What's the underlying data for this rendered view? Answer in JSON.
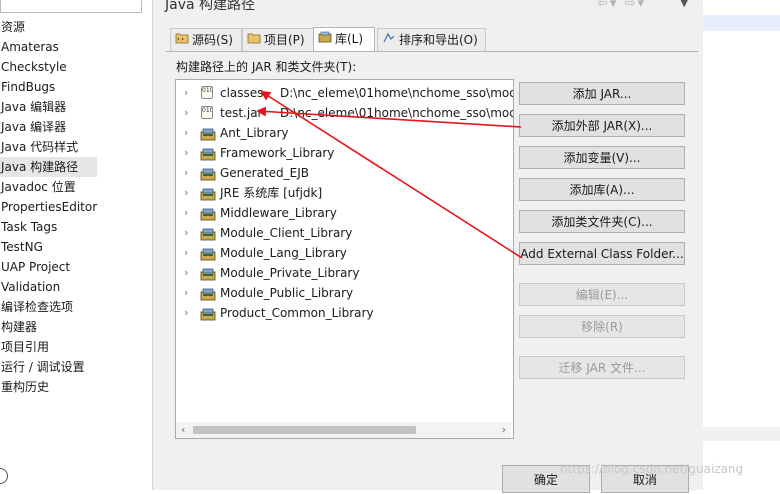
{
  "left_tree": {
    "items": [
      {
        "label": "资源",
        "selected": false
      },
      {
        "label": "Amateras",
        "selected": false
      },
      {
        "label": "Checkstyle",
        "selected": false
      },
      {
        "label": "FindBugs",
        "selected": false
      },
      {
        "label": "Java 编辑器",
        "selected": false
      },
      {
        "label": "Java 编译器",
        "selected": false
      },
      {
        "label": "Java 代码样式",
        "selected": false
      },
      {
        "label": "Java 构建路径",
        "selected": true
      },
      {
        "label": "Javadoc 位置",
        "selected": false
      },
      {
        "label": "PropertiesEditor",
        "selected": false
      },
      {
        "label": "Task Tags",
        "selected": false
      },
      {
        "label": "TestNG",
        "selected": false
      },
      {
        "label": "UAP Project",
        "selected": false
      },
      {
        "label": "Validation",
        "selected": false
      },
      {
        "label": "编译检查选项",
        "selected": false
      },
      {
        "label": "构建器",
        "selected": false
      },
      {
        "label": "项目引用",
        "selected": false
      },
      {
        "label": "运行 / 调试设置",
        "selected": false
      },
      {
        "label": "重构历史",
        "selected": false
      }
    ]
  },
  "page": {
    "title": "Java 构建路径"
  },
  "tabs": [
    {
      "label": "源码(S)",
      "icon": "source-folder-icon",
      "active": false
    },
    {
      "label": "项目(P)",
      "icon": "project-icon",
      "active": false
    },
    {
      "label": "库(L)",
      "icon": "library-icon",
      "active": true
    },
    {
      "label": "排序和导出(O)",
      "icon": "order-export-icon",
      "active": false
    }
  ],
  "libraries": {
    "caption": "构建路径上的 JAR 和类文件夹(T):",
    "entries": [
      {
        "label": "classes",
        "path": "D:\\nc_eleme\\01home\\nchome_sso\\mod",
        "icon": "jar-icon"
      },
      {
        "label": "test.jar",
        "path": "D:\\nc_eleme\\01home\\nchome_sso\\modu",
        "icon": "jar-icon"
      },
      {
        "label": "Ant_Library",
        "path": "",
        "icon": "library-icon"
      },
      {
        "label": "Framework_Library",
        "path": "",
        "icon": "library-icon"
      },
      {
        "label": "Generated_EJB",
        "path": "",
        "icon": "library-icon"
      },
      {
        "label": "JRE 系统库 [ufjdk]",
        "path": "",
        "icon": "library-icon"
      },
      {
        "label": "Middleware_Library",
        "path": "",
        "icon": "library-icon"
      },
      {
        "label": "Module_Client_Library",
        "path": "",
        "icon": "library-icon"
      },
      {
        "label": "Module_Lang_Library",
        "path": "",
        "icon": "library-icon"
      },
      {
        "label": "Module_Private_Library",
        "path": "",
        "icon": "library-icon"
      },
      {
        "label": "Module_Public_Library",
        "path": "",
        "icon": "library-icon"
      },
      {
        "label": "Product_Common_Library",
        "path": "",
        "icon": "library-icon"
      }
    ]
  },
  "buttons": {
    "add_jar": "添加 JAR...",
    "add_external_jar": "添加外部 JAR(X)...",
    "add_variable": "添加变量(V)...",
    "add_library": "添加库(A)...",
    "add_class_folder": "添加类文件夹(C)...",
    "add_external_class_folder": "Add External Class Folder...",
    "edit": "编辑(E)...",
    "remove": "移除(R)",
    "migrate_jar": "迁移 JAR 文件..."
  },
  "dialog": {
    "ok": "确定",
    "cancel": "取消"
  },
  "watermark": "https://blog.csdn.net/guaizang",
  "colors": {
    "arrow": "#e8141b",
    "selected_bg": "#e6e6e6"
  }
}
